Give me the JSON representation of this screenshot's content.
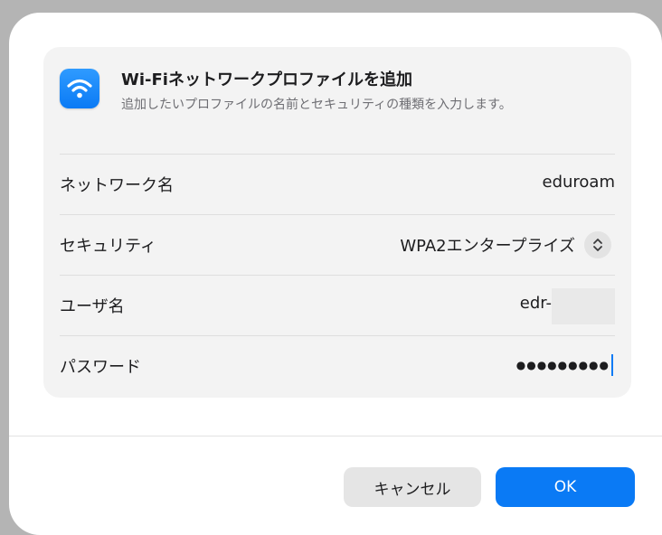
{
  "dialog": {
    "title": "Wi-Fiネットワークプロファイルを追加",
    "subtitle": "追加したいプロファイルの名前とセキュリティの種類を入力します。",
    "icon": "wifi-icon",
    "accent_color": "#0a7af5"
  },
  "form": {
    "network_name": {
      "label": "ネットワーク名",
      "value": "eduroam"
    },
    "security": {
      "label": "セキュリティ",
      "value": "WPA2エンタープライズ",
      "icon": "chevron-up-down-icon"
    },
    "username": {
      "label": "ユーザ名",
      "value": "edr-"
    },
    "password": {
      "label": "パスワード",
      "masked_value": "●●●●●●●●●"
    }
  },
  "buttons": {
    "cancel_label": "キャンセル",
    "ok_label": "OK"
  }
}
